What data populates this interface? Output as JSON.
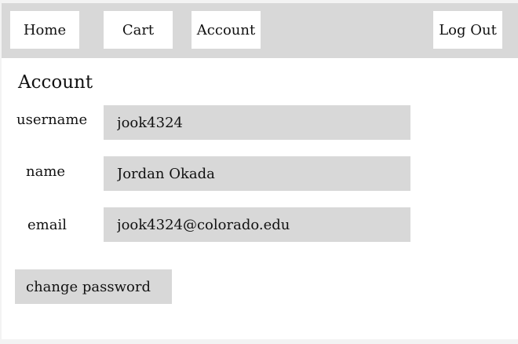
{
  "nav": {
    "home_label": "Home",
    "cart_label": "Cart",
    "account_label": "Account",
    "logout_label": "Log Out"
  },
  "main": {
    "title": "Account",
    "fields": {
      "username": {
        "label": "username",
        "value": "jook4324"
      },
      "name": {
        "label": "name",
        "value": "Jordan Okada"
      },
      "email": {
        "label": "email",
        "value": "jook4324@colorado.edu"
      }
    },
    "change_password_label": "change password"
  },
  "colors": {
    "nav_background": "#d8d8d8",
    "field_background": "#d8d8d8",
    "page_background": "#ffffff"
  }
}
